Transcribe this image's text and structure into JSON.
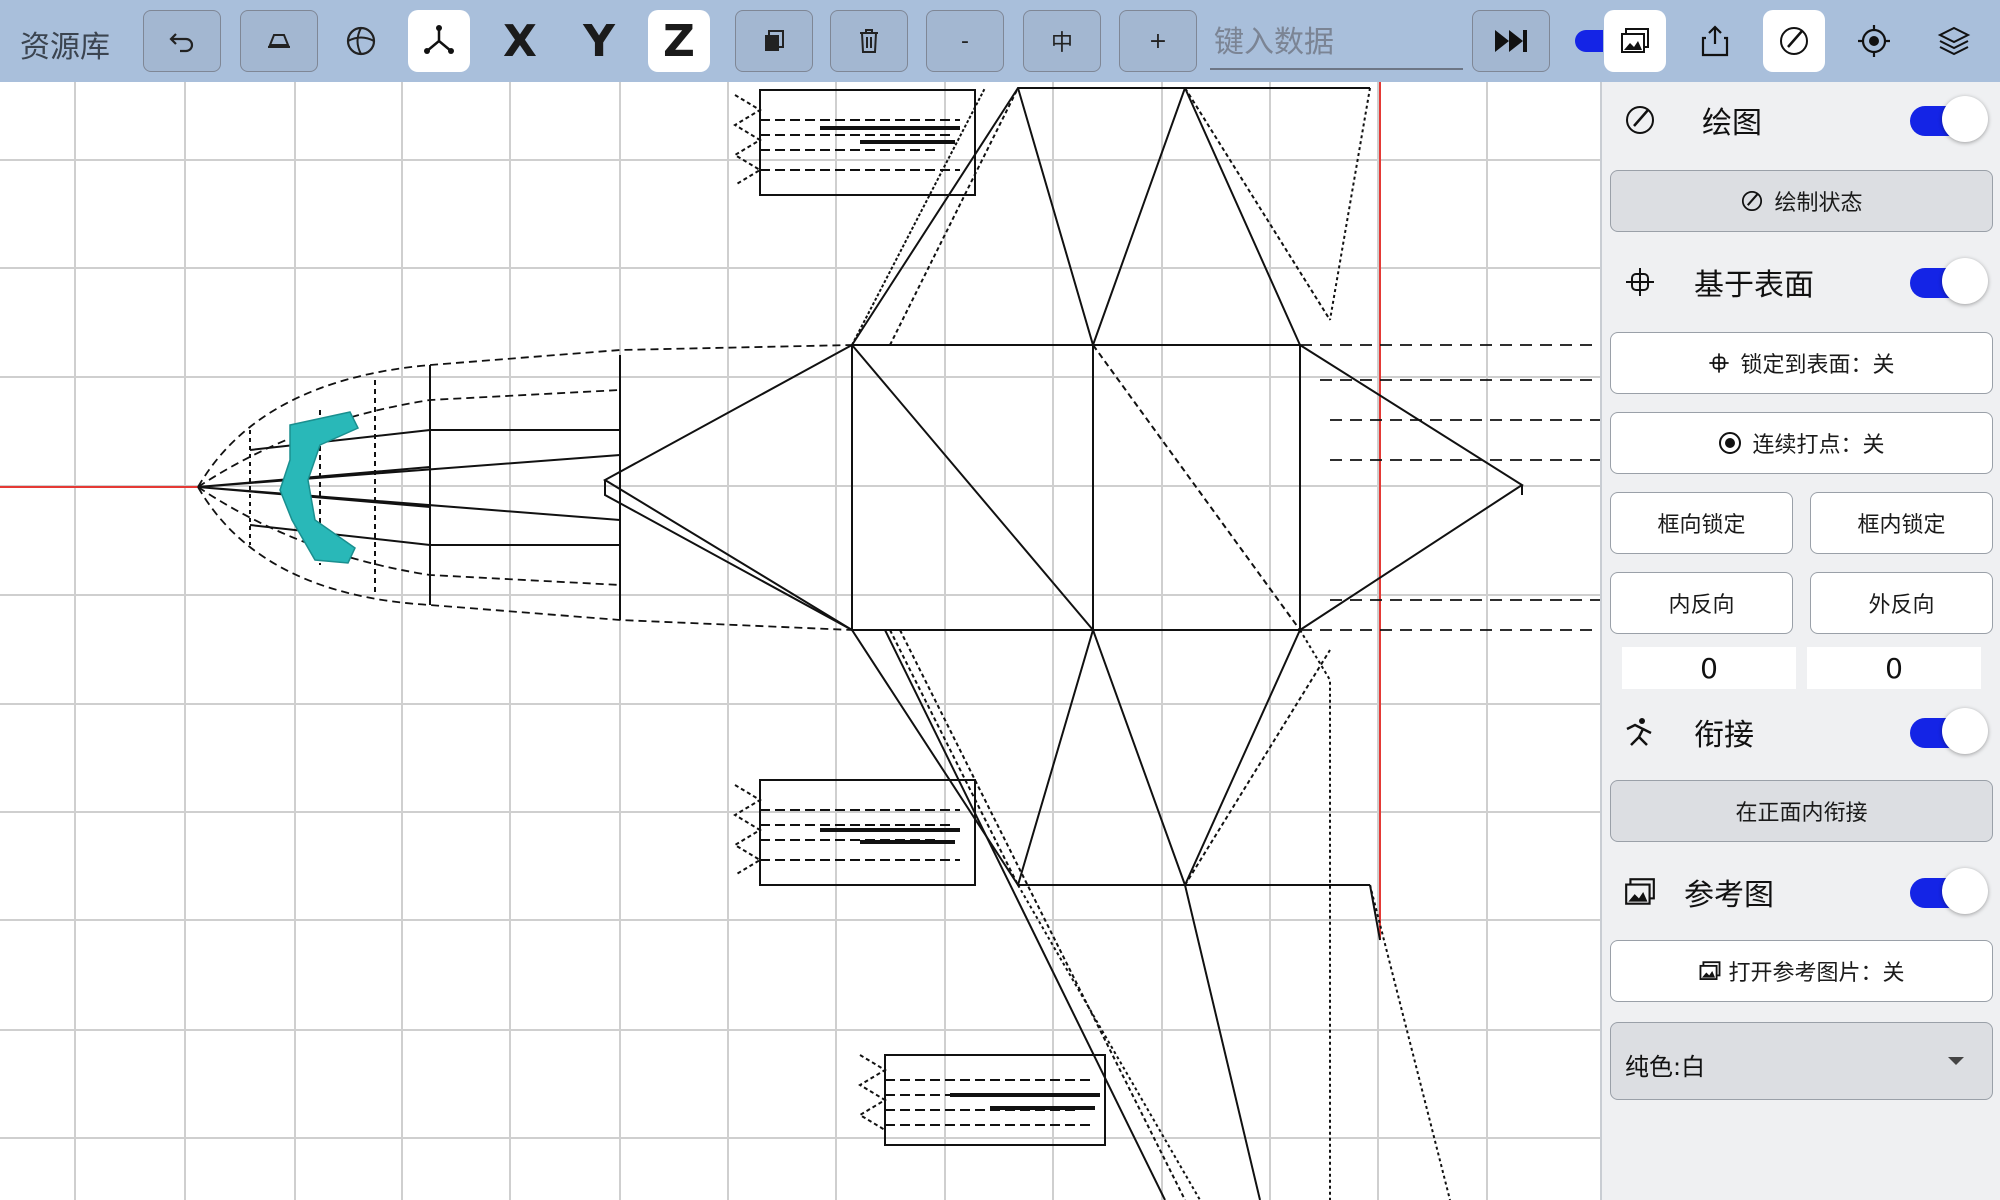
{
  "toolbar": {
    "title": "资源库",
    "buttons": [
      {
        "name": "undo-button",
        "icon": "undo-icon"
      },
      {
        "name": "eraser-button",
        "icon": "eraser-icon"
      },
      {
        "name": "sphere-button",
        "icon": "globe-icon"
      },
      {
        "name": "axes-button",
        "icon": "axes-icon",
        "active": true
      }
    ],
    "axis_x": "X",
    "axis_y": "Y",
    "axis_z": "Z",
    "copy_icon": "copy-icon",
    "delete_icon": "trash-icon",
    "minus_label": "-",
    "center_label": "中",
    "plus_label": "+",
    "input_placeholder": "键入数据",
    "play_icon": "fast-forward-icon",
    "right_icons": [
      "reference-image-icon",
      "share-icon",
      "draw-icon",
      "target-icon",
      "layers-icon"
    ]
  },
  "panel": {
    "draw": {
      "label": "绘图",
      "icon": "pen-circle-icon",
      "on": true,
      "state_button": "绘制状态"
    },
    "surface": {
      "label": "基于表面",
      "icon": "crosshair-icon",
      "on": true,
      "lock_button": "锁定到表面：关",
      "continuous_button": "连续打点：关",
      "box_lock": "框向锁定",
      "inner_lock": "框内锁定",
      "inner_reverse": "内反向",
      "outer_reverse": "外反向",
      "value_left": "0",
      "value_right": "0"
    },
    "join": {
      "label": "衔接",
      "icon": "stick-figure-icon",
      "on": true,
      "button": "在正面内衔接"
    },
    "reference": {
      "label": "参考图",
      "icon": "image-icon",
      "on": true,
      "button": "打开参考图片：关"
    },
    "color_select": "纯色:白"
  },
  "colors": {
    "toolbar": "#a9bfdb",
    "accent": "#1424e6",
    "highlight": "#29b8b8",
    "axis_red": "#e53935"
  }
}
